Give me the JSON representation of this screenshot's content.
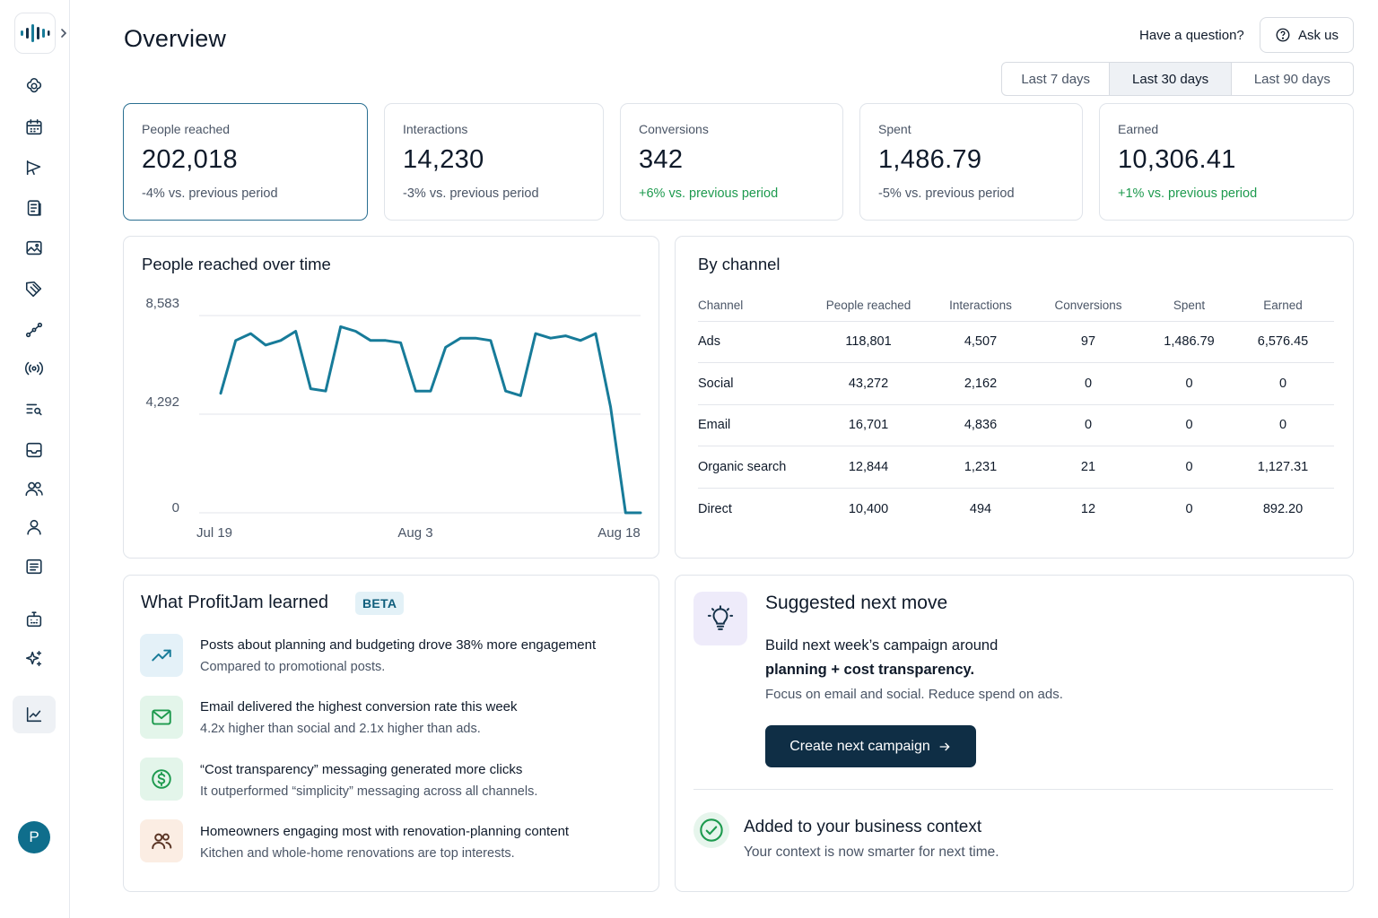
{
  "header": {
    "title": "Overview",
    "question": "Have a question?",
    "ask_label": "Ask us"
  },
  "period_tabs": [
    {
      "label": "Last 7 days",
      "active": false
    },
    {
      "label": "Last 30 days",
      "active": true
    },
    {
      "label": "Last 90 days",
      "active": false
    }
  ],
  "sidebar": {
    "icons": [
      "brain-icon",
      "calendar-icon",
      "megaphone-icon",
      "document-icon",
      "gallery-icon",
      "tag-icon",
      "flow-icon",
      "broadcast-icon",
      "search-list-icon",
      "inbox-icon",
      "users-icon",
      "user-icon",
      "message-icon",
      "robot-icon",
      "sparkle-icon",
      "analytics-icon"
    ],
    "active_item": "analytics-icon",
    "avatar_initial": "P"
  },
  "stats": [
    {
      "label": "People reached",
      "value": "202,018",
      "change": "-4% vs. previous period",
      "trend": "neg"
    },
    {
      "label": "Interactions",
      "value": "14,230",
      "change": "-3% vs. previous period",
      "trend": "neg"
    },
    {
      "label": "Conversions",
      "value": "342",
      "change": "+6% vs. previous period",
      "trend": "pos"
    },
    {
      "label": "Spent",
      "value": "1,486.79",
      "change": "-5% vs. previous period",
      "trend": "neg"
    },
    {
      "label": "Earned",
      "value": "10,306.41",
      "change": "+1% vs. previous period",
      "trend": "pos"
    }
  ],
  "chart_data": {
    "type": "line",
    "title": "People reached over time",
    "x_ticks": [
      "Jul 19",
      "Aug 3",
      "Aug 18"
    ],
    "y_ticks": [
      "8,583",
      "4,292",
      "0"
    ],
    "ylim": [
      0,
      8583
    ],
    "grid": true,
    "color": "#177b99",
    "values": [
      5200,
      7500,
      7800,
      7300,
      7500,
      7900,
      5400,
      5300,
      8100,
      7900,
      7500,
      7500,
      7400,
      5300,
      5300,
      7200,
      7600,
      7600,
      7500,
      5300,
      5100,
      7800,
      7600,
      7700,
      7500,
      7800,
      4600,
      0,
      0
    ]
  },
  "channels": {
    "title": "By channel",
    "columns": [
      "Channel",
      "People reached",
      "Interactions",
      "Conversions",
      "Spent",
      "Earned"
    ],
    "rows": [
      [
        "Ads",
        "118,801",
        "4,507",
        "97",
        "1,486.79",
        "6,576.45"
      ],
      [
        "Social",
        "43,272",
        "2,162",
        "0",
        "0",
        "0"
      ],
      [
        "Email",
        "16,701",
        "4,836",
        "0",
        "0",
        "0"
      ],
      [
        "Organic search",
        "12,844",
        "1,231",
        "21",
        "0",
        "1,127.31"
      ],
      [
        "Direct",
        "10,400",
        "494",
        "12",
        "0",
        "892.20"
      ]
    ]
  },
  "learned": {
    "title": "What ProfitJam learned",
    "badge": "BETA",
    "items": [
      {
        "icon": "trend-up-icon",
        "title": "Posts about planning and budgeting drove 38% more engagement",
        "sub": "Compared to promotional posts."
      },
      {
        "icon": "mail-icon",
        "title": "Email delivered the highest conversion rate this week",
        "sub": "4.2x higher than social and 2.1x higher than ads."
      },
      {
        "icon": "dollar-icon",
        "title": "“Cost transparency” messaging generated more clicks",
        "sub": "It outperformed “simplicity” messaging across all channels."
      },
      {
        "icon": "people-icon",
        "title": "Homeowners engaging most with renovation-planning content",
        "sub": "Kitchen and whole-home renovations are top interests."
      }
    ]
  },
  "suggested": {
    "title": "Suggested next move",
    "line1": "Build next week’s campaign around",
    "line2": "planning + cost transparency.",
    "line3": "Focus on email and social. Reduce spend on ads.",
    "cta": "Create next campaign",
    "added_title": "Added to your business context",
    "added_sub": "Your context is now smarter for next time."
  },
  "colors": {
    "accent": "#177b99",
    "primary_dark": "#0f2e45",
    "positive": "#1d9a4e"
  }
}
